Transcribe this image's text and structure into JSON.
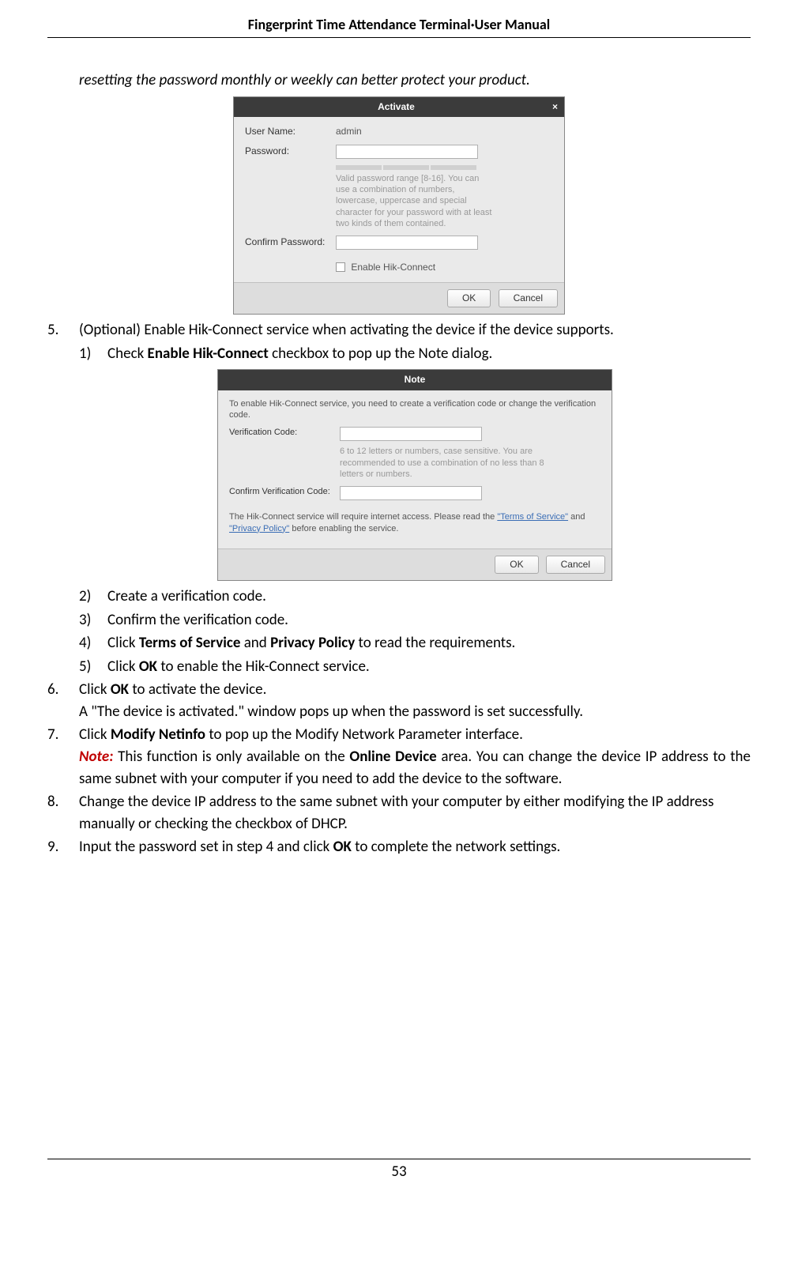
{
  "header": {
    "title": "Fingerprint Time Attendance Terminal·User Manual"
  },
  "intro": {
    "text": "resetting the password monthly or weekly can better protect your product."
  },
  "dialog1": {
    "title": "Activate",
    "close": "×",
    "username_label": "User Name:",
    "username_value": "admin",
    "password_label": "Password:",
    "hint": "Valid password range [8-16]. You can use a combination of numbers, lowercase, uppercase and special character for your password with at least two kinds of them contained.",
    "confirm_label": "Confirm Password:",
    "enable_label": "Enable Hik-Connect",
    "ok": "OK",
    "cancel": "Cancel"
  },
  "step5": {
    "num": "5.",
    "text": "(Optional) Enable Hik-Connect service when activating the device if the device supports.",
    "sub1_num": "1)",
    "sub1_a": "Check ",
    "sub1_b": "Enable Hik-Connect",
    "sub1_c": " checkbox to pop up the Note dialog."
  },
  "dialog2": {
    "title": "Note",
    "intro": "To enable Hik-Connect service, you need to create a verification code or change the verification code.",
    "vc_label": "Verification Code:",
    "vc_hint": "6 to 12 letters or numbers, case sensitive. You are recommended to use a combination of no less than 8 letters or numbers.",
    "cvc_label": "Confirm Verification Code:",
    "terms_a": "The Hik-Connect service will require internet access. Please read the ",
    "terms_link1": "\"Terms of Service\"",
    "terms_b": " and ",
    "terms_link2": "\"Privacy Policy\"",
    "terms_c": " before enabling the service.",
    "ok": "OK",
    "cancel": "Cancel"
  },
  "s5_2": {
    "num": "2)",
    "text": "Create a verification code."
  },
  "s5_3": {
    "num": "3)",
    "text": "Confirm the verification code."
  },
  "s5_4": {
    "num": "4)",
    "a": "Click ",
    "b": "Terms of Service",
    "c": " and ",
    "d": "Privacy Policy",
    "e": " to read the requirements."
  },
  "s5_5": {
    "num": "5)",
    "a": "Click ",
    "b": "OK",
    "c": " to enable the Hik-Connect service."
  },
  "step6": {
    "num": "6.",
    "a": "Click ",
    "b": "OK",
    "c": " to activate the device.",
    "line2": "A \"The device is activated.\" window pops up when the password is set successfully."
  },
  "step7": {
    "num": "7.",
    "a": "Click ",
    "b": "Modify Netinfo",
    "c": " to pop up the Modify Network Parameter interface.",
    "note_label": "Note:",
    "note_a": " This function is only available on the ",
    "note_b": "Online Device",
    "note_c": " area. You can change the device IP address to the same subnet with your computer if you need to add the device to the software."
  },
  "step8": {
    "num": "8.",
    "text": "Change the device IP address to the same subnet with your computer by either modifying the IP address manually or checking the checkbox of DHCP."
  },
  "step9": {
    "num": "9.",
    "a": "Input the password set in step 4 and click ",
    "b": "OK",
    "c": " to complete the network settings."
  },
  "footer": {
    "page": "53"
  }
}
